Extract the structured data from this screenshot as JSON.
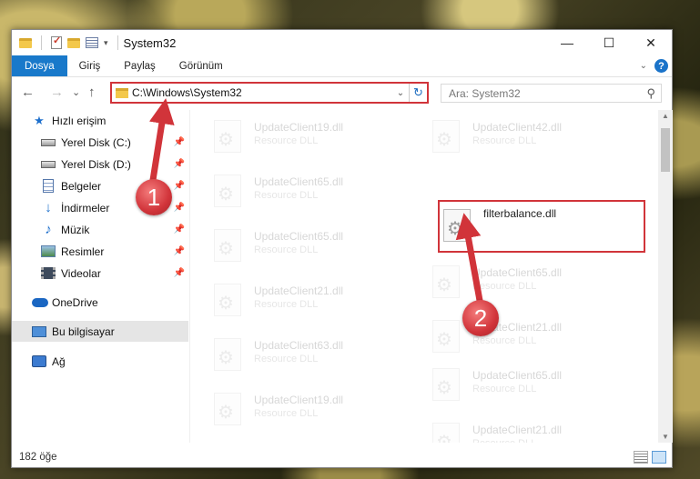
{
  "window": {
    "title": "System32",
    "controls": {
      "minimize": "—",
      "maximize": "☐",
      "close": "✕"
    }
  },
  "ribbon": {
    "tabs": [
      "Dosya",
      "Giriş",
      "Paylaş",
      "Görünüm"
    ],
    "help_label": "?"
  },
  "nav": {
    "back": "←",
    "forward": "→",
    "recent": "⌄",
    "up": "↑",
    "address": "C:\\Windows\\System32",
    "search_placeholder": "Ara: System32"
  },
  "sidebar": {
    "items": [
      {
        "label": "Hızlı erişim",
        "icon": "star-icon",
        "pinned": false
      },
      {
        "label": "Yerel Disk (C:)",
        "icon": "disk-icon",
        "pinned": true
      },
      {
        "label": "Yerel Disk (D:)",
        "icon": "disk-icon",
        "pinned": true
      },
      {
        "label": "Belgeler",
        "icon": "documents-icon",
        "pinned": true
      },
      {
        "label": "İndirmeler",
        "icon": "downloads-icon",
        "pinned": true
      },
      {
        "label": "Müzik",
        "icon": "music-icon",
        "pinned": true
      },
      {
        "label": "Resimler",
        "icon": "pictures-icon",
        "pinned": true
      },
      {
        "label": "Videolar",
        "icon": "videos-icon",
        "pinned": true
      },
      {
        "label": "OneDrive",
        "icon": "onedrive-icon",
        "pinned": false
      },
      {
        "label": "Bu bilgisayar",
        "icon": "this-pc-icon",
        "pinned": false,
        "selected": true
      },
      {
        "label": "Ağ",
        "icon": "network-icon",
        "pinned": false
      }
    ]
  },
  "files": {
    "type_label": "Resource DLL",
    "left_column": [
      "UpdateClient19.dll",
      "UpdateClient65.dll",
      "UpdateClient65.dll",
      "UpdateClient21.dll",
      "UpdateClient63.dll",
      "UpdateClient19.dll"
    ],
    "right_column": [
      "UpdateClient42.dll",
      "filterbalance.dll",
      "UpdateClient65.dll",
      "UpdateClient21.dll",
      "UpdateClient65.dll",
      "UpdateClient21.dll"
    ],
    "highlighted": "filterbalance.dll"
  },
  "status": {
    "count": "182 öğe"
  },
  "annotations": {
    "callout1": "1",
    "callout2": "2",
    "color": "#d1343a"
  }
}
